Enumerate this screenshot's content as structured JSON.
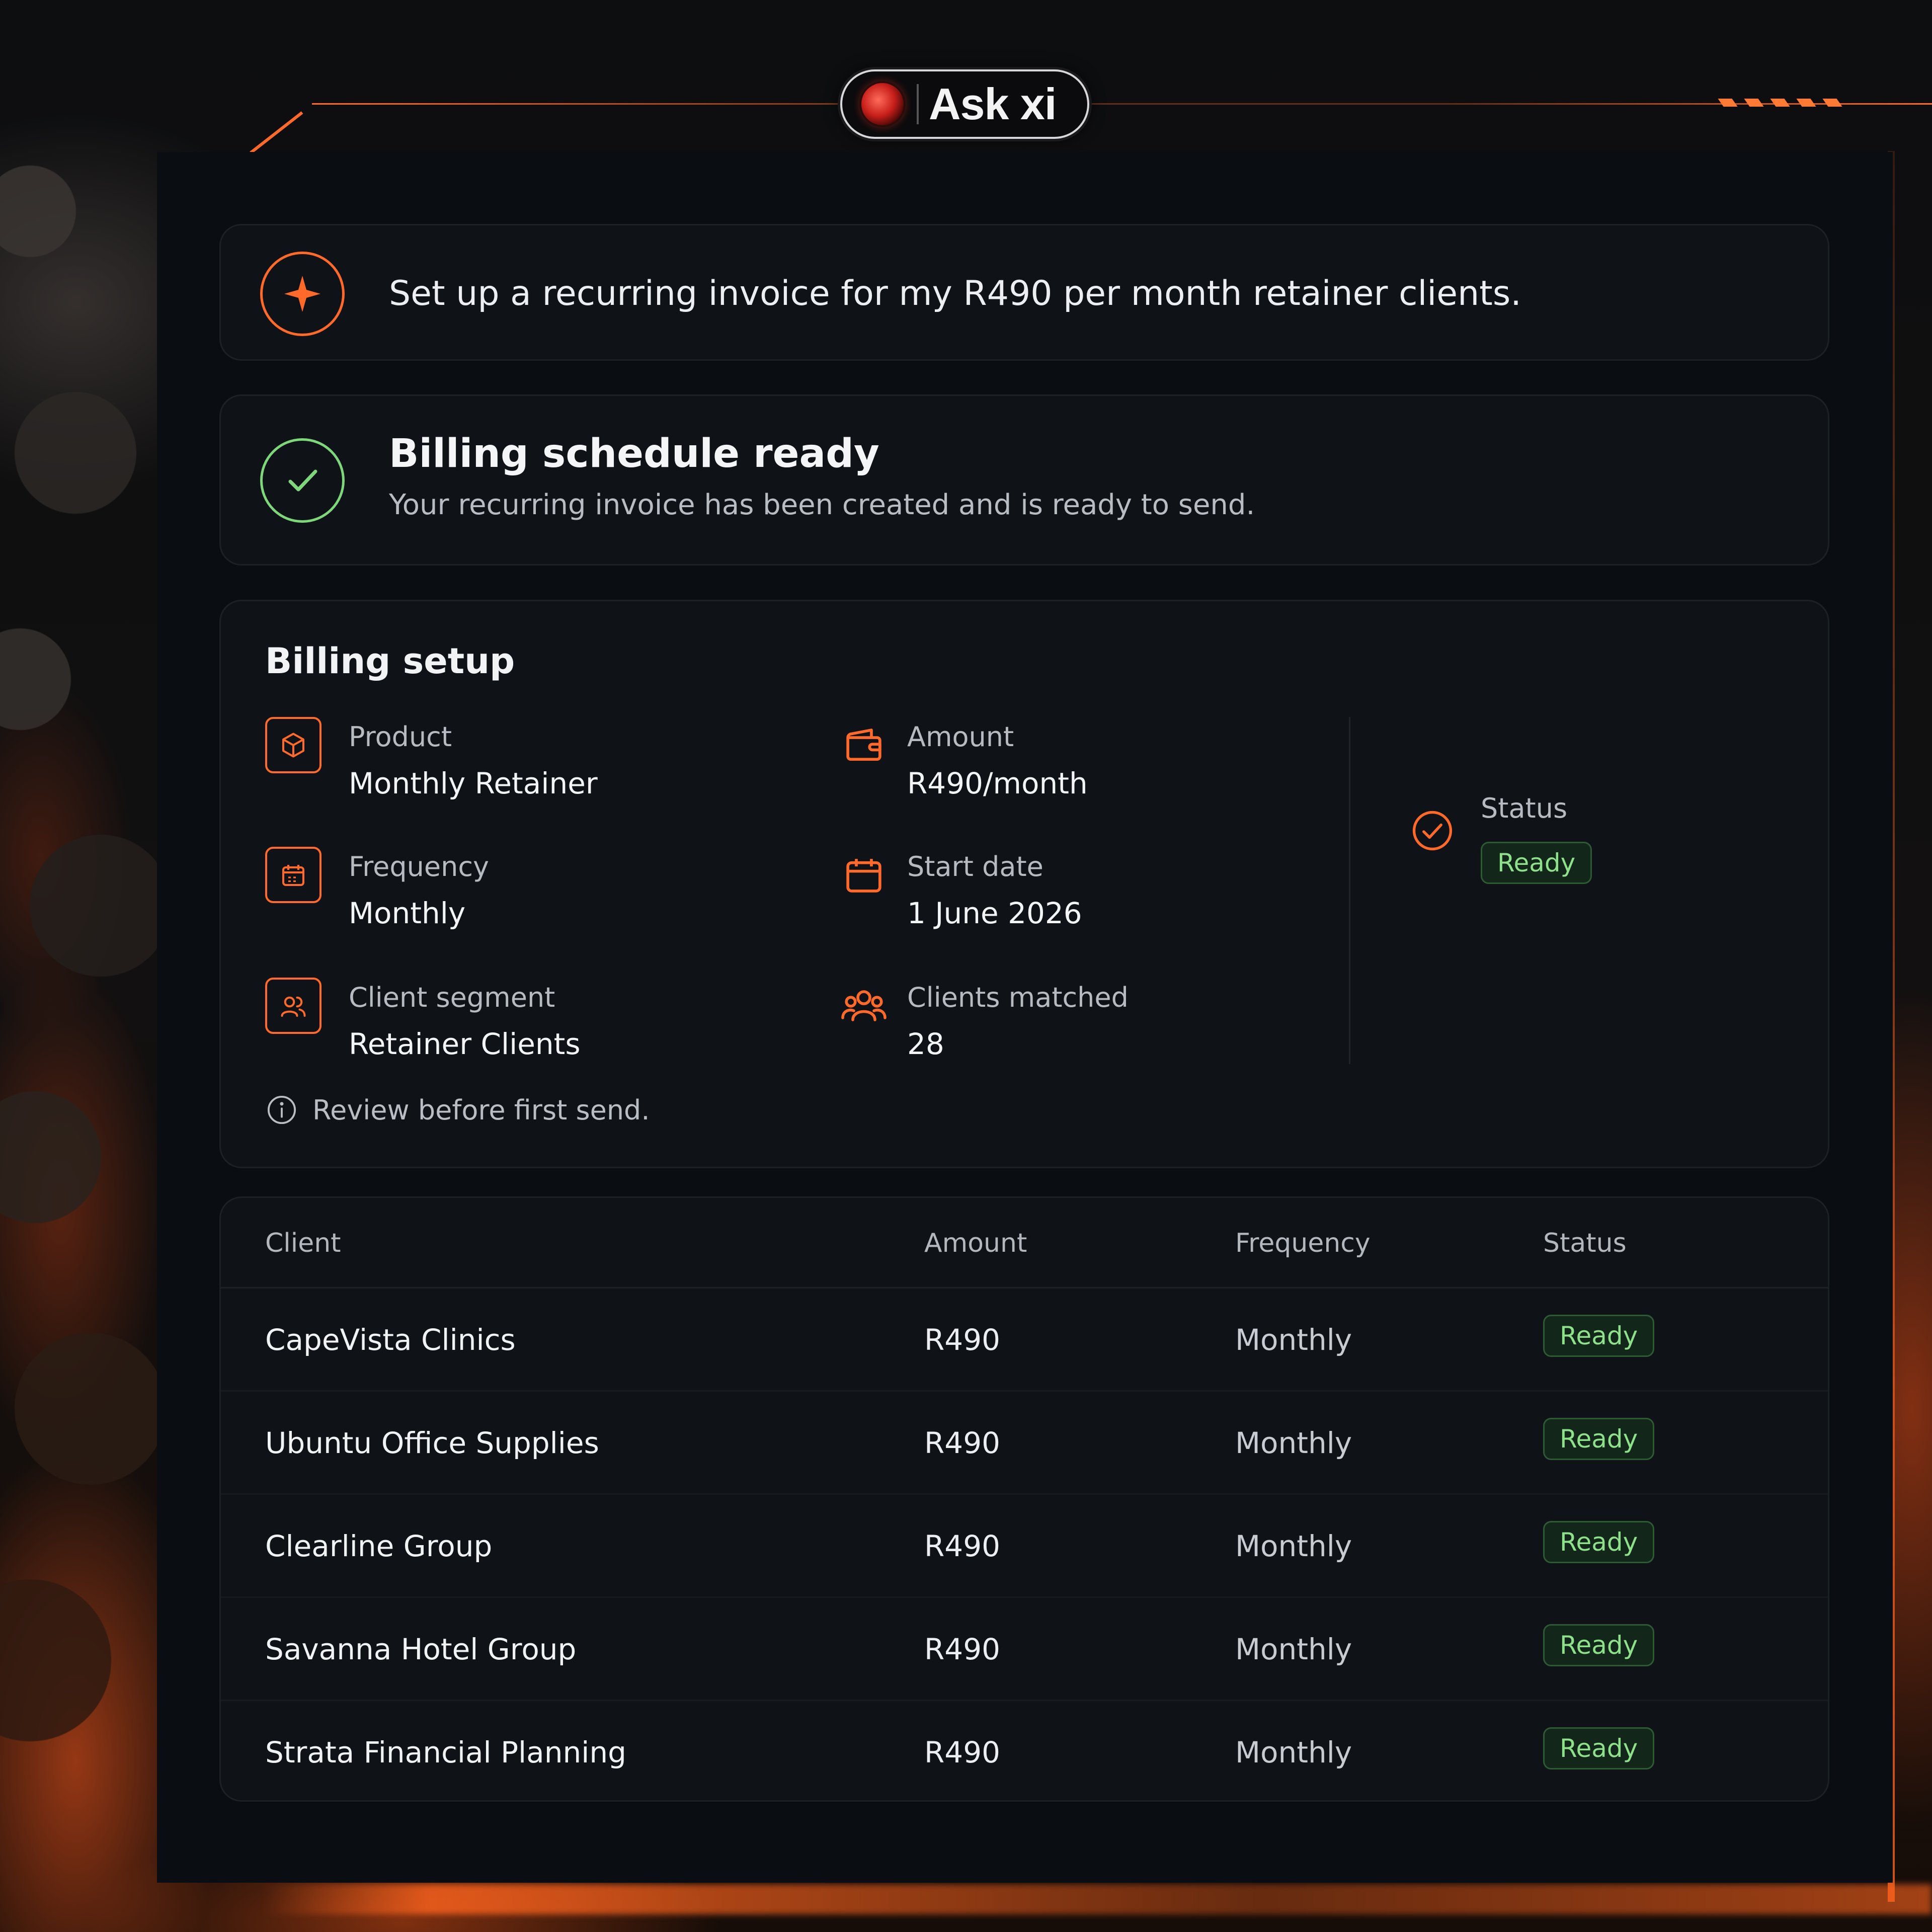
{
  "brand": {
    "name": "Ask xi",
    "accent": "#ff6a2a",
    "success": "#7ed77a"
  },
  "prompt": {
    "icon": "sparkle-icon",
    "text": "Set up a recurring invoice for my R490 per month retainer clients."
  },
  "result": {
    "icon": "check-circle-icon",
    "title": "Billing schedule ready",
    "subtitle": "Your recurring invoice has been created and is ready to send."
  },
  "setup": {
    "title": "Billing setup",
    "product": {
      "label": "Product",
      "value": "Monthly Retainer",
      "icon": "box-icon"
    },
    "amount": {
      "label": "Amount",
      "value": "R490/month",
      "icon": "wallet-icon"
    },
    "frequency": {
      "label": "Frequency",
      "value": "Monthly",
      "icon": "calendar-icon"
    },
    "start_date": {
      "label": "Start date",
      "value": "1 June 2026",
      "icon": "calendar-icon"
    },
    "segment": {
      "label": "Client segment",
      "value": "Retainer Clients",
      "icon": "users-icon"
    },
    "matched": {
      "label": "Clients matched",
      "value": "28",
      "icon": "group-icon"
    },
    "status": {
      "label": "Status",
      "value": "Ready",
      "icon": "check-circle-icon"
    },
    "note": "Review before first send."
  },
  "table": {
    "headers": {
      "client": "Client",
      "amount": "Amount",
      "frequency": "Frequency",
      "status": "Status"
    },
    "rows": [
      {
        "client": "CapeVista Clinics",
        "amount": "R490",
        "frequency": "Monthly",
        "status": "Ready"
      },
      {
        "client": "Ubuntu Office Supplies",
        "amount": "R490",
        "frequency": "Monthly",
        "status": "Ready"
      },
      {
        "client": "Clearline Group",
        "amount": "R490",
        "frequency": "Monthly",
        "status": "Ready"
      },
      {
        "client": "Savanna Hotel Group",
        "amount": "R490",
        "frequency": "Monthly",
        "status": "Ready"
      },
      {
        "client": "Strata Financial Planning",
        "amount": "R490",
        "frequency": "Monthly",
        "status": "Ready"
      }
    ]
  }
}
